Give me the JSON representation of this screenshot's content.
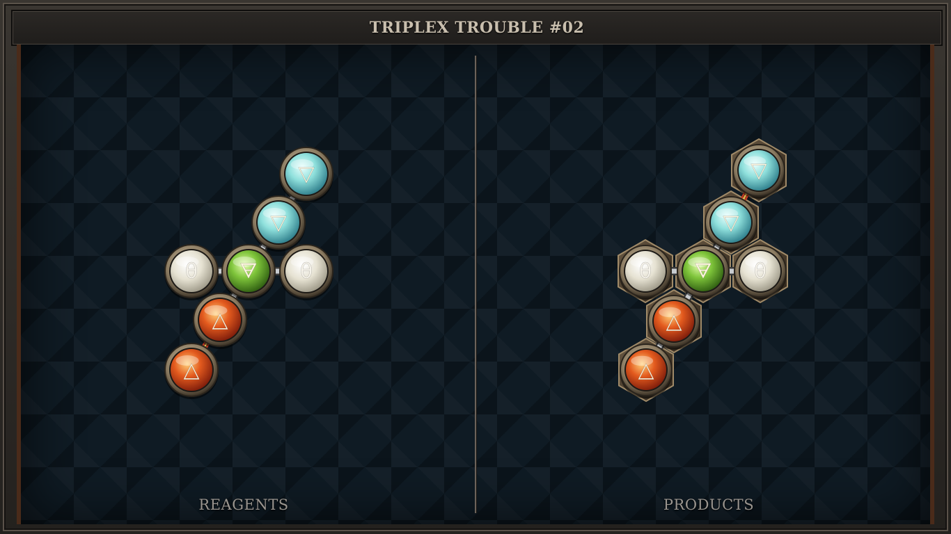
{
  "title": "TRIPLEX TROUBLE #02",
  "panels": {
    "reagents_label": "REAGENTS",
    "products_label": "PRODUCTS"
  },
  "element_colors": {
    "water": "#8fe0dc",
    "earth": "#7ec43a",
    "fire": "#e35a1e",
    "salt": "#e6e2d2"
  },
  "reagents": {
    "atoms": [
      {
        "element": "water",
        "symbol": "▽"
      },
      {
        "element": "water",
        "symbol": "▽"
      },
      {
        "element": "salt",
        "symbol": "θ"
      },
      {
        "element": "earth",
        "symbol": "🜃"
      },
      {
        "element": "salt",
        "symbol": "θ"
      },
      {
        "element": "fire",
        "symbol": "△"
      },
      {
        "element": "fire",
        "symbol": "△"
      }
    ],
    "bonds": [
      {
        "from": 0,
        "to": 1,
        "type": "normal"
      },
      {
        "from": 1,
        "to": 3,
        "type": "normal"
      },
      {
        "from": 2,
        "to": 3,
        "type": "normal"
      },
      {
        "from": 3,
        "to": 4,
        "type": "normal"
      },
      {
        "from": 3,
        "to": 5,
        "type": "normal"
      },
      {
        "from": 5,
        "to": 6,
        "type": "triplex"
      }
    ]
  },
  "products": {
    "atoms": [
      {
        "element": "water",
        "symbol": "▽"
      },
      {
        "element": "water",
        "symbol": "▽"
      },
      {
        "element": "salt",
        "symbol": "θ"
      },
      {
        "element": "earth",
        "symbol": "🜃"
      },
      {
        "element": "salt",
        "symbol": "θ"
      },
      {
        "element": "fire",
        "symbol": "△"
      },
      {
        "element": "fire",
        "symbol": "△"
      }
    ],
    "bonds": [
      {
        "from": 0,
        "to": 1,
        "type": "triplex"
      },
      {
        "from": 1,
        "to": 3,
        "type": "normal"
      },
      {
        "from": 2,
        "to": 3,
        "type": "normal"
      },
      {
        "from": 3,
        "to": 4,
        "type": "normal"
      },
      {
        "from": 3,
        "to": 5,
        "type": "normal"
      },
      {
        "from": 5,
        "to": 6,
        "type": "normal"
      }
    ]
  }
}
